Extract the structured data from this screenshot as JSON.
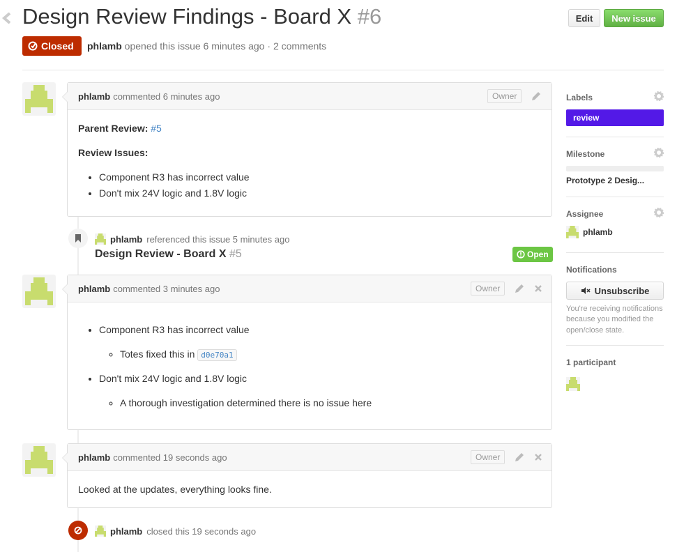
{
  "issue": {
    "title": "Design Review Findings - Board X",
    "number": "#6",
    "state": "Closed",
    "author": "phlamb",
    "opened_text": "opened this issue 6 minutes ago",
    "separator": "·",
    "comments_count": "2 comments"
  },
  "header": {
    "edit_label": "Edit",
    "new_issue_label": "New issue"
  },
  "comments": [
    {
      "author": "phlamb",
      "time": "commented 6 minutes ago",
      "role": "Owner",
      "parent_label": "Parent Review:",
      "parent_link": "#5",
      "issues_label": "Review Issues:",
      "items": [
        "Component R3 has incorrect value",
        "Don't mix 24V logic and 1.8V logic"
      ]
    },
    {
      "author": "phlamb",
      "time": "commented 3 minutes ago",
      "role": "Owner",
      "item1": "Component R3 has incorrect value",
      "sub1_text": "Totes fixed this in",
      "sub1_code": "d0e70a1",
      "item2": "Don't mix 24V logic and 1.8V logic",
      "sub2_text": "A thorough investigation determined there is no issue here"
    },
    {
      "author": "phlamb",
      "time": "commented 19 seconds ago",
      "role": "Owner",
      "body": "Looked at the updates, everything looks fine."
    }
  ],
  "events": {
    "reference": {
      "author": "phlamb",
      "text": "referenced this issue 5 minutes ago",
      "title": "Design Review - Board X",
      "number": "#5",
      "state": "Open"
    },
    "closed": {
      "author": "phlamb",
      "text": "closed this 19 seconds ago"
    }
  },
  "sidebar": {
    "labels_title": "Labels",
    "label": "review",
    "label_color": "#5319e7",
    "milestone_title": "Milestone",
    "milestone_name": "Prototype 2 Desig...",
    "assignee_title": "Assignee",
    "assignee": "phlamb",
    "notifications_title": "Notifications",
    "unsubscribe_label": "Unsubscribe",
    "notif_note": "You're receiving notifications because you modified the open/close state.",
    "participants_title": "1 participant"
  },
  "colors": {
    "closed": "#bd2c00",
    "open": "#6cc644",
    "new_issue": "#60b044",
    "link": "#4183c4",
    "avatar": "#c8dc6e"
  },
  "icons": [
    "chevron-left-icon",
    "issue-closed-icon",
    "pencil-icon",
    "close-icon",
    "bookmark-icon",
    "issue-opened-icon",
    "gear-icon",
    "mute-icon",
    "circle-slash-icon"
  ]
}
